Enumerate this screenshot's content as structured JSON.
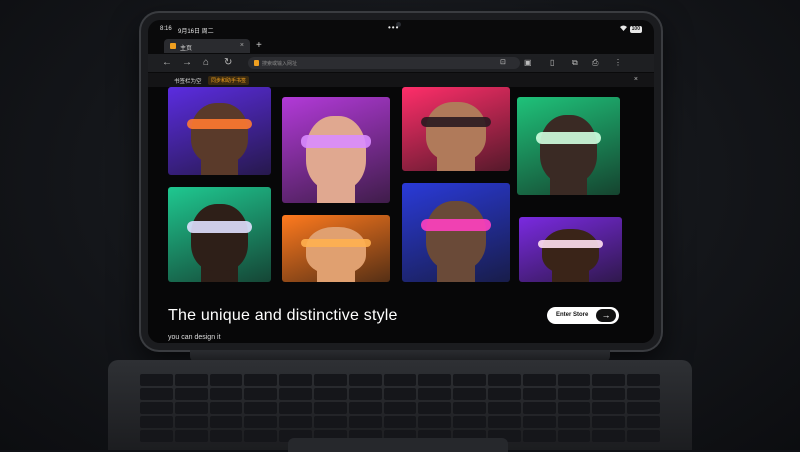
{
  "status_bar": {
    "time": "8:16",
    "date": "9月16日 周二",
    "dots": "•••",
    "battery": "100"
  },
  "tab": {
    "title": "主页",
    "close": "×",
    "new_tab": "+"
  },
  "address_bar": {
    "placeholder": "搜索或输入网址"
  },
  "bookmarks": {
    "item1": "书签栏为空",
    "item2": "同步和助手书签",
    "close": "×"
  },
  "page": {
    "headline": "The unique and distinctive style",
    "subline": "you can design it",
    "cta_label": "Enter Store",
    "cta_arrow": "→"
  },
  "colors": {
    "accent": "#f0a020",
    "background": "#070708"
  },
  "photos": [
    {
      "bg": "#5b2ce0",
      "skin": "#5a3a2a",
      "glasses": "#ff7a30"
    },
    {
      "bg": "#b23ad8",
      "skin": "#e0a890",
      "glasses": "#d98cff"
    },
    {
      "bg": "#ff2e6a",
      "skin": "#b07a5a",
      "glasses": "#2a1a20"
    },
    {
      "bg": "#1fc27a",
      "skin": "#3a2a24",
      "glasses": "#d0ffe0"
    },
    {
      "bg": "#1fc890",
      "skin": "#2e1f18",
      "glasses": "#e0e0ff"
    },
    {
      "bg": "#ff7a1e",
      "skin": "#e0a070",
      "glasses": "#ffb050"
    },
    {
      "bg": "#2a3ad8",
      "skin": "#6a4a38",
      "glasses": "#ff40c0"
    },
    {
      "bg": "#7a2ae0",
      "skin": "#3a2418",
      "glasses": "#ffe0f0"
    }
  ]
}
